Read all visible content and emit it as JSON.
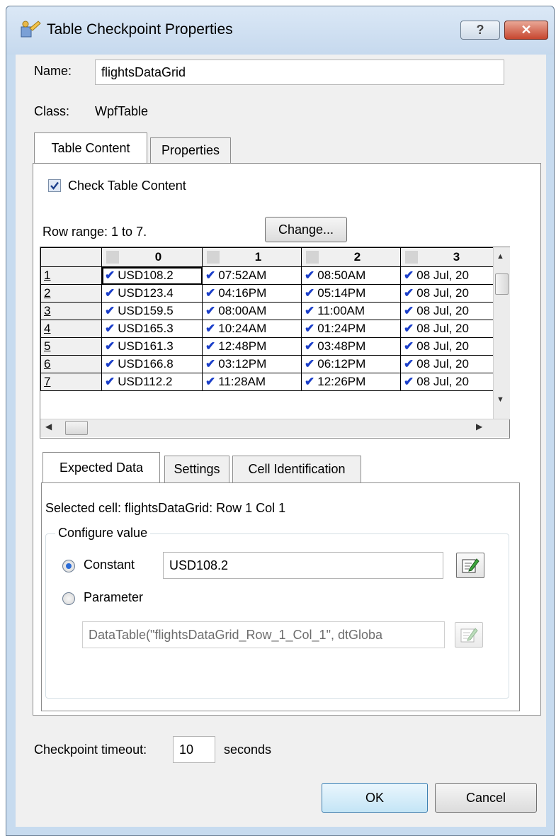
{
  "window": {
    "title": "Table Checkpoint Properties",
    "help_label": "?",
    "close_label": "✕"
  },
  "name_label": "Name:",
  "name_value": "flightsDataGrid",
  "class_label": "Class:",
  "class_value": "WpfTable",
  "tabs": [
    "Table Content",
    "Properties"
  ],
  "check_table_content_label": "Check Table Content",
  "row_range_text": "Row range: 1 to 7.",
  "change_button": "Change...",
  "grid": {
    "columns": [
      "0",
      "1",
      "2",
      "3"
    ],
    "rows": [
      {
        "label": "1",
        "cells": [
          "USD108.2",
          "07:52AM",
          "08:50AM",
          "08 Jul, 20"
        ]
      },
      {
        "label": "2",
        "cells": [
          "USD123.4",
          "04:16PM",
          "05:14PM",
          "08 Jul, 20"
        ]
      },
      {
        "label": "3",
        "cells": [
          "USD159.5",
          "08:00AM",
          "11:00AM",
          "08 Jul, 20"
        ]
      },
      {
        "label": "4",
        "cells": [
          "USD165.3",
          "10:24AM",
          "01:24PM",
          "08 Jul, 20"
        ]
      },
      {
        "label": "5",
        "cells": [
          "USD161.3",
          "12:48PM",
          "03:48PM",
          "08 Jul, 20"
        ]
      },
      {
        "label": "6",
        "cells": [
          "USD166.8",
          "03:12PM",
          "06:12PM",
          "08 Jul, 20"
        ]
      },
      {
        "label": "7",
        "cells": [
          "USD112.2",
          "11:28AM",
          "12:26PM",
          "08 Jul, 20"
        ]
      }
    ]
  },
  "sub_tabs": [
    "Expected Data",
    "Settings",
    "Cell Identification"
  ],
  "selected_cell_text": "Selected cell: flightsDataGrid: Row 1 Col 1",
  "configure_value_label": "Configure value",
  "constant_label": "Constant",
  "constant_value": "USD108.2",
  "parameter_label": "Parameter",
  "parameter_value": "DataTable(\"flightsDataGrid_Row_1_Col_1\", dtGloba",
  "timeout_label": "Checkpoint timeout:",
  "timeout_value": "10",
  "seconds_label": "seconds",
  "ok_button": "OK",
  "cancel_button": "Cancel"
}
